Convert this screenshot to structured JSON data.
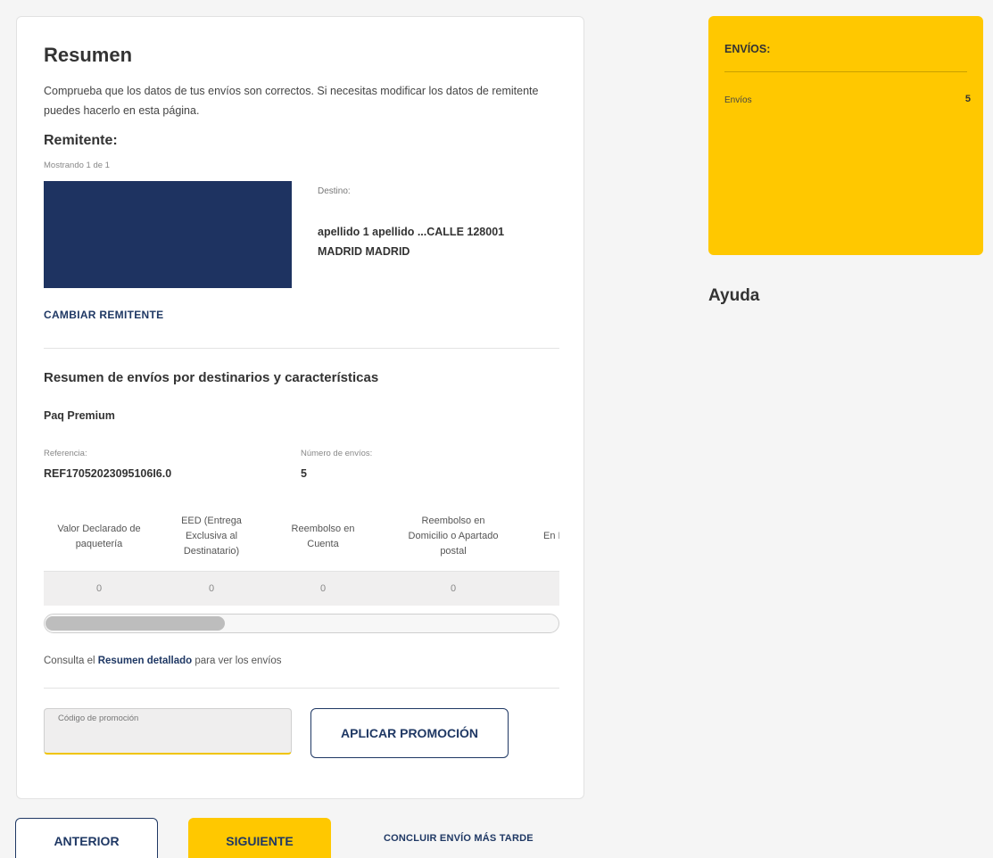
{
  "summary": {
    "title": "Resumen",
    "intro": "Comprueba que los datos de tus envíos son correctos. Si necesitas modificar los datos de remitente puedes hacerlo en esta página.",
    "remitente_title": "Remitente:",
    "showing": "Mostrando 1 de 1",
    "destino_label": "Destino:",
    "destino_value": "apellido 1 apellido ...CALLE 128001 MADRID MADRID",
    "change_sender": "CAMBIAR REMITENTE",
    "section_title": "Resumen de envíos por destinarios y características",
    "product": "Paq Premium",
    "ref_label": "Referencia:",
    "ref_value": "REF17052023095106I6.0",
    "count_label": "Número de envíos:",
    "count_value": "5"
  },
  "table": {
    "headers": [
      "Valor Declarado de paquetería",
      "EED (Entrega Exclusiva al Destinatario)",
      "Reembolso en Cuenta",
      "Reembolso en Domicilio o Apartado postal",
      "En I"
    ],
    "row": [
      "0",
      "0",
      "0",
      "0",
      ""
    ],
    "scroll_fraction": 0.35
  },
  "consulta": {
    "prefix": "Consulta el ",
    "link": "Resumen detallado",
    "suffix": " para ver los envíos"
  },
  "promo": {
    "placeholder": "Código de promoción",
    "apply_label": "APLICAR PROMOCIÓN"
  },
  "actions": {
    "prev_label": "ANTERIOR",
    "next_label": "SIGUIENTE",
    "later_label": "CONCLUIR ENVÍO MÁS TARDE"
  },
  "sidebar": {
    "envios_title": "ENVÍOS:",
    "envios_label": "Envíos",
    "envios_count": "5",
    "help_title": "Ayuda"
  },
  "colors": {
    "accent_yellow": "#ffc800",
    "navy": "#1f3864",
    "sender_block": "#1e3361"
  }
}
